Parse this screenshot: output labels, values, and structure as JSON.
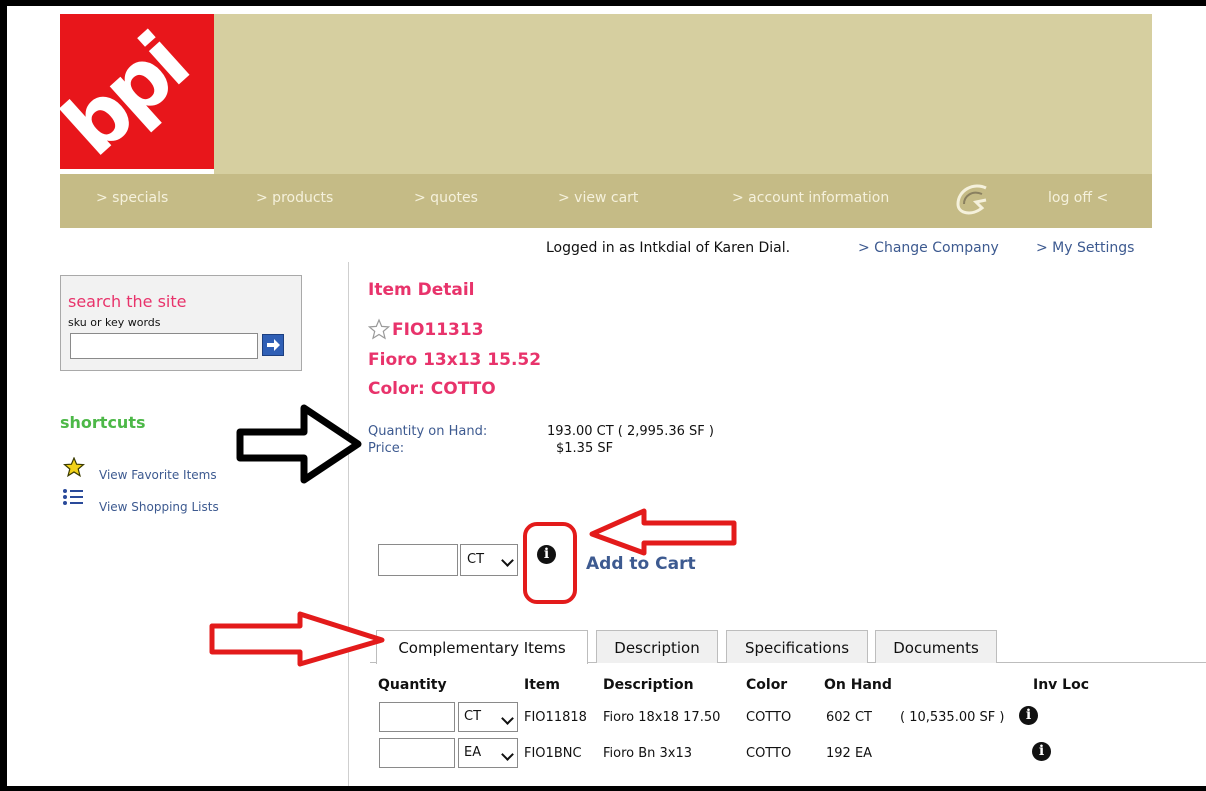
{
  "logo": {
    "text": "bpi"
  },
  "nav": {
    "specials": "> specials",
    "products": "> products",
    "quotes": "> quotes",
    "view_cart": "> view cart",
    "account_information": "> account information",
    "log_off": "log off <"
  },
  "user_bar": {
    "logged_in": "Logged in as Intkdial of Karen Dial.",
    "change_company": "> Change Company",
    "my_settings": "> My Settings"
  },
  "search": {
    "title": "search the site",
    "subtitle": "sku or key words",
    "value": ""
  },
  "shortcuts": {
    "title": "shortcuts",
    "favorites": "View Favorite Items",
    "shopping_lists": "View Shopping Lists"
  },
  "item": {
    "heading": "Item Detail",
    "sku": "FIO11313",
    "name": "Fioro 13x13 15.52",
    "color": "Color: COTTO",
    "qty_label": "Quantity on Hand:",
    "qty_value": "193.00 CT ( 2,995.36 SF )",
    "price_label": "Price:",
    "price_value": "$1.35 SF"
  },
  "order": {
    "quantity": "",
    "unit": "CT",
    "add_to_cart": "Add to Cart"
  },
  "tabs": [
    "Complementary Items",
    "Description",
    "Specifications",
    "Documents"
  ],
  "table": {
    "headers": [
      "Quantity",
      "Item",
      "Description",
      "Color",
      "On Hand",
      "Inv Loc"
    ],
    "rows": [
      {
        "unit": "CT",
        "item": "FIO11818",
        "description": "Fioro 18x18 17.50",
        "color": "COTTO",
        "on_hand": "602 CT",
        "on_hand_sf": "( 10,535.00 SF )"
      },
      {
        "unit": "EA",
        "item": "FIO1BNC",
        "description": "Fioro Bn 3x13",
        "color": "COTTO",
        "on_hand": "192 EA",
        "on_hand_sf": ""
      }
    ]
  },
  "icons": {
    "info_glyph": "i"
  },
  "colors": {
    "brand_red": "#e8161b",
    "header_tan": "#d6cfa0",
    "nav_tan": "#c5bb86",
    "accent_pink": "#e8336b",
    "link_blue": "#3d5a90",
    "shortcut_green": "#4db848",
    "annotation_red": "#e31b1b"
  }
}
